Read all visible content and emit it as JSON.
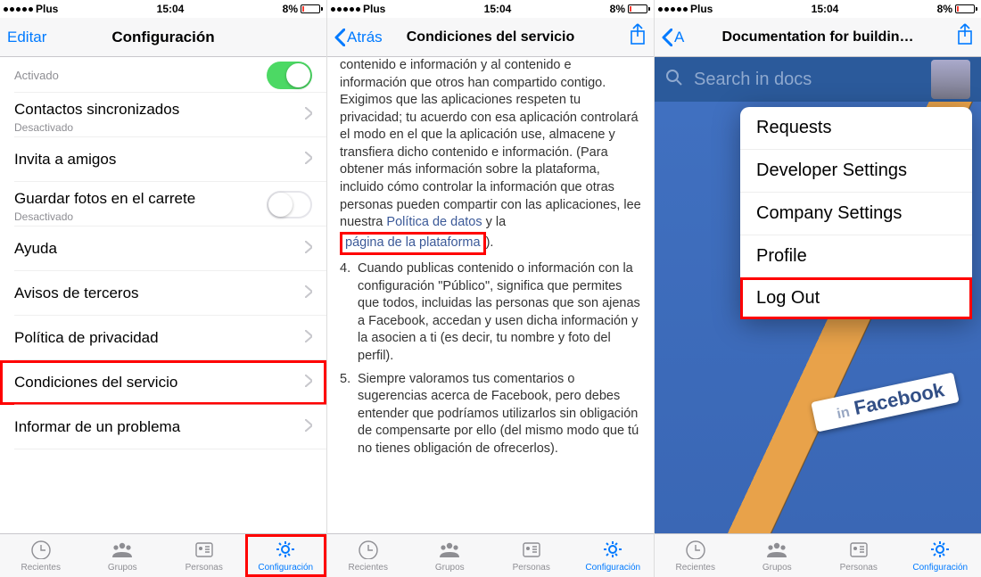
{
  "status": {
    "carrier": "Plus",
    "time": "15:04",
    "battery_pct": "8%"
  },
  "tabs": {
    "recent": "Recientes",
    "groups": "Grupos",
    "people": "Personas",
    "settings": "Configuración"
  },
  "screen1": {
    "nav_edit": "Editar",
    "nav_title": "Configuración",
    "rows": {
      "activated": {
        "label": "Activado"
      },
      "contacts": {
        "label": "Contactos sincronizados",
        "sub": "Desactivado"
      },
      "invite": {
        "label": "Invita a amigos"
      },
      "save_photos": {
        "label": "Guardar fotos en el carrete",
        "sub": "Desactivado"
      },
      "help": {
        "label": "Ayuda"
      },
      "third_party": {
        "label": "Avisos de terceros"
      },
      "privacy": {
        "label": "Política de privacidad"
      },
      "tos": {
        "label": "Condiciones del servicio"
      },
      "report": {
        "label": "Informar de un problema"
      }
    }
  },
  "screen2": {
    "nav_back": "Atrás",
    "nav_title": "Condiciones del servicio",
    "lead_fragment": "contenido e información y al contenido e información que otros han compartido contigo. Exigimos que las aplicaciones respeten tu privacidad; tu acuerdo con esa aplicación controlará el modo en el que la aplicación use, almacene y transfiera dicho contenido e información. (Para obtener más información sobre la plataforma, incluido cómo controlar la información que otras personas pueden compartir con las aplicaciones, lee nuestra ",
    "link_policy": "Política de datos",
    "joiner": " y la ",
    "link_platform": "página de la plataforma",
    "tail": ").",
    "item4_num": "4.",
    "item4": "Cuando publicas contenido o información con la configuración \"Público\", significa que permites que todos, incluidas las personas que son ajenas a Facebook, accedan y usen dicha información y la asocien a ti (es decir, tu nombre y foto del perfil).",
    "item5_num": "5.",
    "item5": "Siempre valoramos tus comentarios o sugerencias acerca de Facebook, pero debes entender que podríamos utilizarlos sin obligación de compensarte por ello (del mismo modo que tú no tienes obligación de ofrecerlos)."
  },
  "screen3": {
    "nav_back_short": "A",
    "nav_title": "Documentation for buildin…",
    "search_placeholder": "Search in docs",
    "fb_tag_prefix": "in",
    "fb_tag": "Facebook",
    "menu": {
      "requests": "Requests",
      "dev_settings": "Developer Settings",
      "company_settings": "Company Settings",
      "profile": "Profile",
      "logout": "Log Out"
    }
  }
}
